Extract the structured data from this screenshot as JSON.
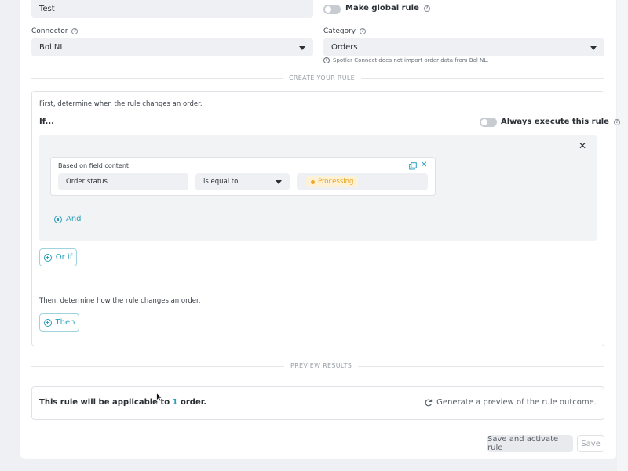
{
  "form": {
    "name_value": "Test",
    "global_rule_label": "Make global rule",
    "connector_label": "Connector",
    "connector_value": "Bol NL",
    "category_label": "Category",
    "category_value": "Orders",
    "category_note": "Spotler Connect does not import order data from Bol NL."
  },
  "create_rule": {
    "section_label": "CREATE YOUR RULE",
    "intro": "First, determine when the rule changes an order.",
    "if_label": "If...",
    "always_execute_label": "Always execute this rule",
    "condition": {
      "title": "Based on field content",
      "field": "Order status",
      "operator": "is equal to",
      "value": "Processing"
    },
    "and_label": "And",
    "or_if_label": "Or if",
    "then_intro": "Then, determine how the rule changes an order.",
    "then_label": "Then"
  },
  "preview": {
    "section_label": "PREVIEW RESULTS",
    "text_before": "This rule will be applicable to ",
    "count": "1",
    "text_after": " order.",
    "generate_label": "Generate a preview of the rule outcome."
  },
  "footer": {
    "save_activate_label": "Save and activate rule",
    "save_label": "Save"
  },
  "colors": {
    "accent": "#2a9fbc",
    "badge_bg": "#fdf1d8",
    "badge_text": "#e6a31b"
  }
}
